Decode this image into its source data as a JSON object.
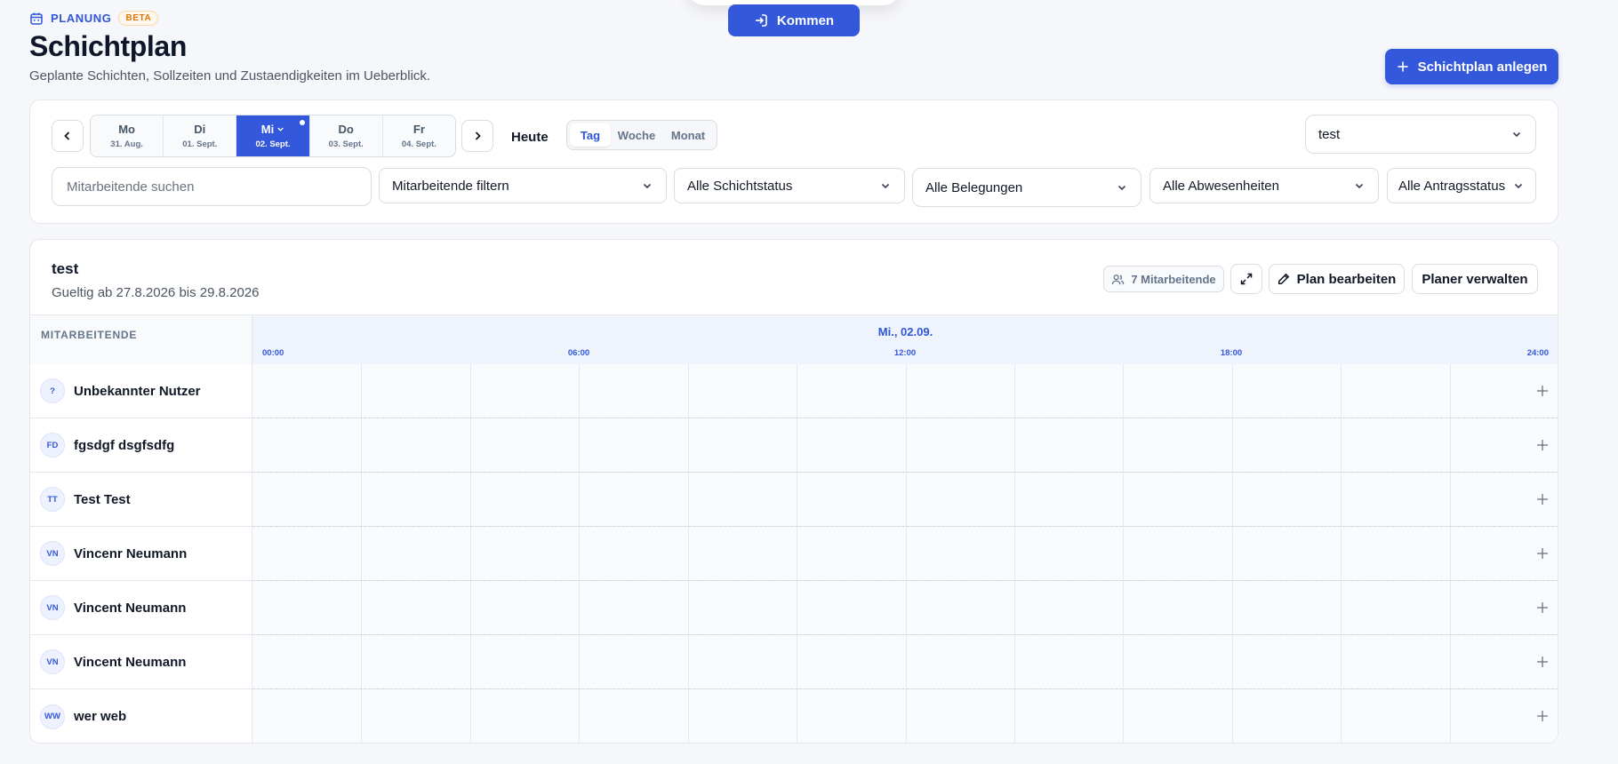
{
  "header": {
    "eyebrow": "PLANUNG",
    "beta": "BETA",
    "title": "Schichtplan",
    "subtitle": "Geplante Schichten, Sollzeiten und Zustaendigkeiten im Ueberblick."
  },
  "kommen_label": "Kommen",
  "create_label": "Schichtplan anlegen",
  "days": [
    {
      "name": "Mo",
      "date": "31. Aug."
    },
    {
      "name": "Di",
      "date": "01. Sept."
    },
    {
      "name": "Mi",
      "date": "02. Sept."
    },
    {
      "name": "Do",
      "date": "03. Sept."
    },
    {
      "name": "Fr",
      "date": "04. Sept."
    }
  ],
  "active_day": "Mi",
  "today_label": "Heute",
  "views": [
    "Tag",
    "Woche",
    "Monat"
  ],
  "active_view": "Tag",
  "plan_select": "test",
  "search_placeholder": "Mitarbeitende suchen",
  "filter_selects": [
    "Mitarbeitende filtern",
    "Alle Schichtstatus",
    "Alle Belegungen",
    "Alle Abwesenheiten",
    "Alle Antragsstatus"
  ],
  "plan": {
    "title": "test",
    "validity": "Gueltig ab 27.8.2026 bis 29.8.2026",
    "employee_count": "7 Mitarbeitende",
    "edit_label": "Plan bearbeiten",
    "manage_label": "Planer verwalten"
  },
  "grid": {
    "employee_header": "MITARBEITENDE",
    "date_label": "Mi., 02.09.",
    "ticks": [
      "00:00",
      "06:00",
      "12:00",
      "18:00",
      "24:00"
    ]
  },
  "employees": [
    {
      "initials": "?",
      "name": "Unbekannter Nutzer"
    },
    {
      "initials": "FD",
      "name": "fgsdgf dsgfsdfg"
    },
    {
      "initials": "TT",
      "name": "Test Test"
    },
    {
      "initials": "VN",
      "name": "Vincenr Neumann"
    },
    {
      "initials": "VN",
      "name": "Vincent Neumann"
    },
    {
      "initials": "VN",
      "name": "Vincent Neumann"
    },
    {
      "initials": "WW",
      "name": "wer web"
    }
  ],
  "colors": {
    "accent": "#3358db",
    "beta": "#d97706"
  }
}
